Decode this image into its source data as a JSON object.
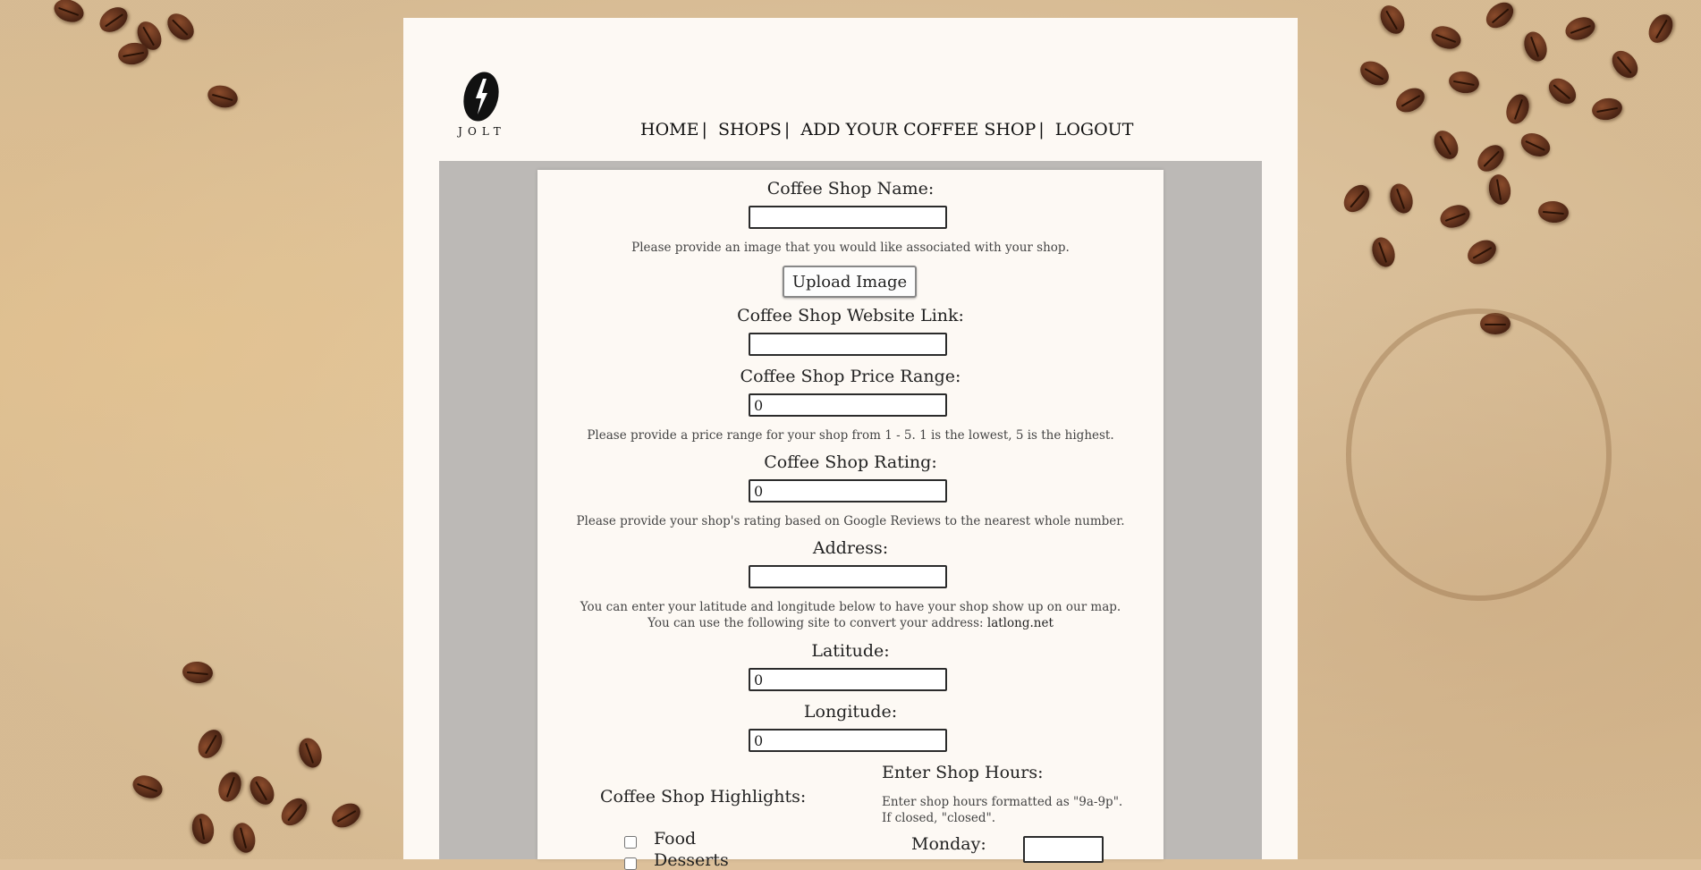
{
  "logo": {
    "text": "JOLT"
  },
  "nav": {
    "items": [
      "HOME",
      "SHOPS",
      "ADD YOUR COFFEE SHOP",
      "LOGOUT"
    ],
    "separator": "|"
  },
  "form": {
    "name_label": "Coffee Shop Name:",
    "name_value": "",
    "image_hint": "Please provide an image that you would like associated with your shop.",
    "upload_button": "Upload Image",
    "website_label": "Coffee Shop Website Link:",
    "website_value": "",
    "price_label": "Coffee Shop Price Range:",
    "price_value": "0",
    "price_hint": "Please provide a price range for your shop from 1 - 5. 1 is the lowest, 5 is the highest.",
    "rating_label": "Coffee Shop Rating:",
    "rating_value": "0",
    "rating_hint": "Please provide your shop's rating based on Google Reviews to the nearest whole number.",
    "address_label": "Address:",
    "address_value": "",
    "latlong_hint_1": "You can enter your latitude and longitude below to have your shop show up on our map.",
    "latlong_hint_2": "You can use the following site to convert your address:",
    "latlong_link": "latlong.net",
    "latitude_label": "Latitude:",
    "latitude_value": "0",
    "longitude_label": "Longitude:",
    "longitude_value": "0",
    "highlights_title": "Coffee Shop Highlights:",
    "highlights": [
      "Food",
      "Desserts"
    ],
    "hours_title": "Enter Shop Hours:",
    "hours_hint": "Enter shop hours formatted as \"9a-9p\". If closed, \"closed\".",
    "monday_label": "Monday:",
    "monday_value": ""
  }
}
